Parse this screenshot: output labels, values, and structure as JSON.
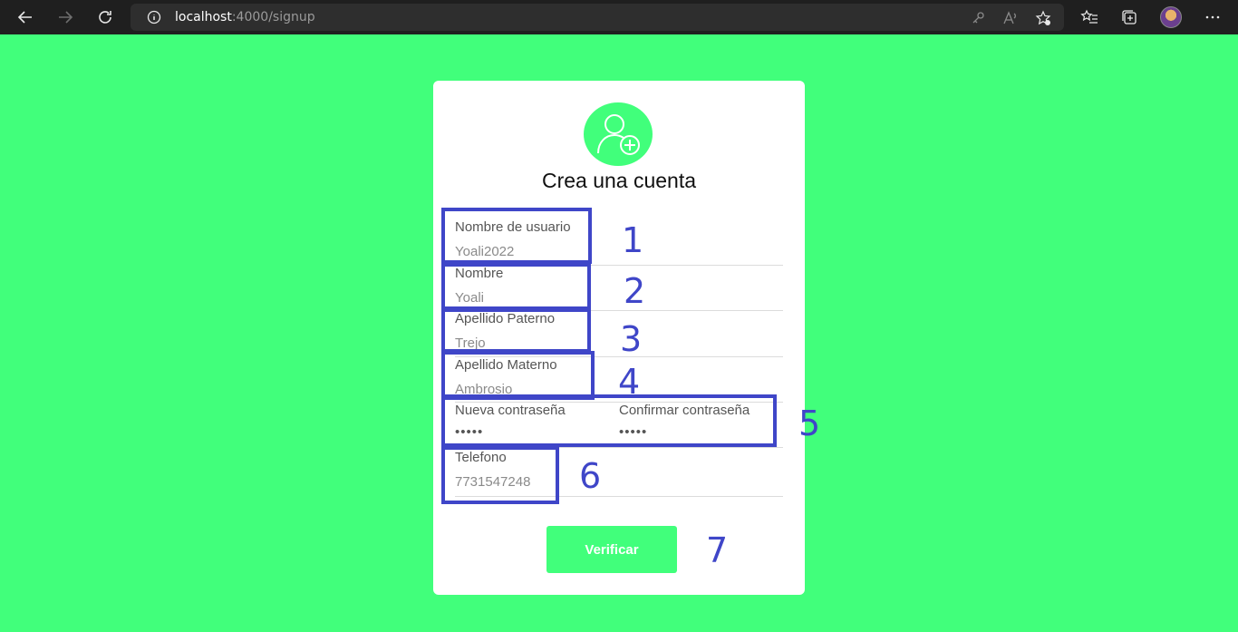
{
  "browser": {
    "url_host": "localhost",
    "url_path": ":4000/signup"
  },
  "form": {
    "title": "Crea una cuenta",
    "fields": [
      {
        "label": "Nombre de usuario",
        "value": "Yoali2022"
      },
      {
        "label": "Nombre",
        "value": "Yoali"
      },
      {
        "label": "Apellido Paterno",
        "value": "Trejo"
      },
      {
        "label": "Apellido Materno",
        "value": "Ambrosio"
      },
      {
        "label": "Nueva contraseña",
        "value": "•••••"
      },
      {
        "label": "Confirmar contraseña",
        "value": "•••••"
      },
      {
        "label": "Telefono",
        "value": "7731547248"
      }
    ],
    "submit_label": "Verificar"
  },
  "annotations": [
    "1",
    "2",
    "3",
    "4",
    "5",
    "6",
    "7"
  ],
  "colors": {
    "background": "#41ff7b",
    "annotation": "#3f46c8"
  }
}
